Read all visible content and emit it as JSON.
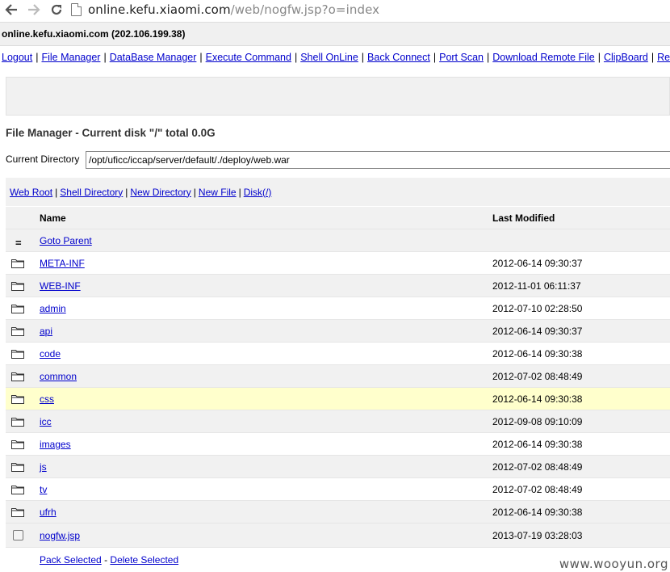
{
  "browser": {
    "url_domain": "online.kefu.xiaomi.com",
    "url_path": "/web/nogfw.jsp?o=index"
  },
  "host": "online.kefu.xiaomi.com (202.106.199.38)",
  "menu": [
    "Logout",
    "File Manager",
    "DataBase Manager",
    "Execute Command",
    "Shell OnLine",
    "Back Connect",
    "Port Scan",
    "Download Remote File",
    "ClipBoard",
    "Remote"
  ],
  "file_manager": {
    "title": "File Manager - Current disk \"/\" total 0.0G",
    "current_dir_label": "Current Directory",
    "current_dir_value": "/opt/uficc/iccap/server/default/./deploy/web.war"
  },
  "quick_links": [
    "Web Root",
    "Shell Directory",
    "New Directory",
    "New File",
    "Disk(/)"
  ],
  "table": {
    "col_name": "Name",
    "col_modified": "Last Modified",
    "goto_parent": "Goto Parent",
    "rows": [
      {
        "name": "META-INF",
        "modified": "2012-06-14 09:30:37"
      },
      {
        "name": "WEB-INF",
        "modified": "2012-11-01 06:11:37"
      },
      {
        "name": "admin",
        "modified": "2012-07-10 02:28:50"
      },
      {
        "name": "api",
        "modified": "2012-06-14 09:30:37"
      },
      {
        "name": "code",
        "modified": "2012-06-14 09:30:38"
      },
      {
        "name": "common",
        "modified": "2012-07-02 08:48:49"
      },
      {
        "name": "css",
        "modified": "2012-06-14 09:30:38"
      },
      {
        "name": "icc",
        "modified": "2012-09-08 09:10:09"
      },
      {
        "name": "images",
        "modified": "2012-06-14 09:30:38"
      },
      {
        "name": "js",
        "modified": "2012-07-02 08:48:49"
      },
      {
        "name": "tv",
        "modified": "2012-07-02 08:48:49"
      },
      {
        "name": "ufrh",
        "modified": "2012-06-14 09:30:38"
      }
    ],
    "file": {
      "name": "nogfw.jsp",
      "modified": "2013-07-19 03:28:03"
    }
  },
  "actions": {
    "pack": "Pack Selected",
    "separator": "-",
    "delete": "Delete Selected"
  },
  "watermark": "www.wooyun.org",
  "colors": {
    "link": "#0000cc",
    "highlight_row": "#ffffcc",
    "panel_bg": "#f1f1f1"
  }
}
